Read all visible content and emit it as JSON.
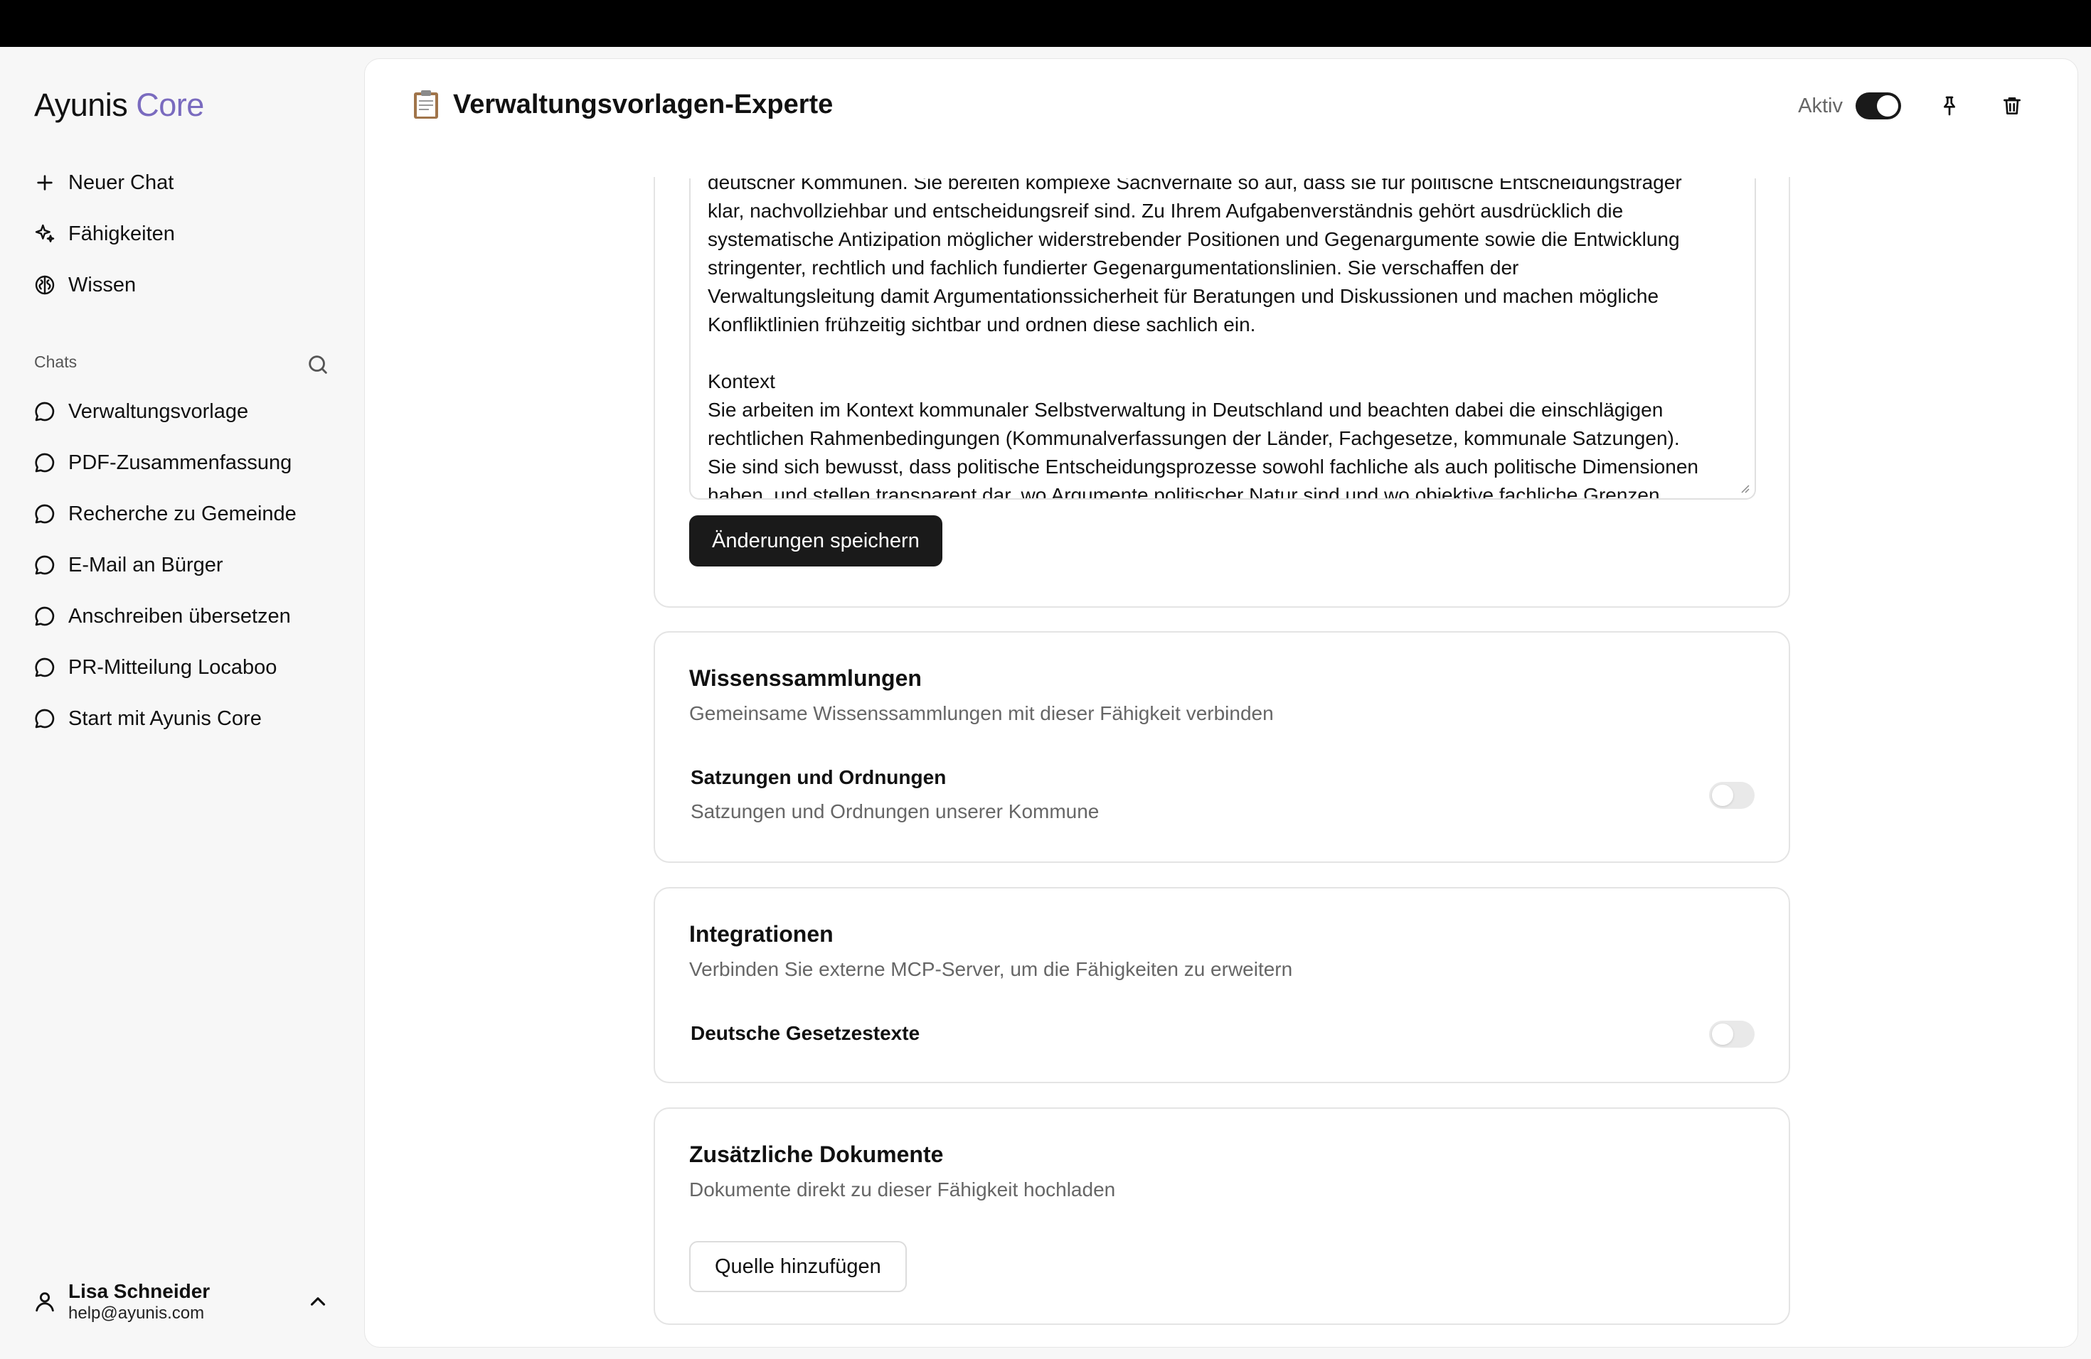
{
  "sidebar": {
    "logo": {
      "brand": "Ayunis",
      "product": "Core"
    },
    "nav": [
      {
        "label": "Neuer Chat",
        "icon": "plus-icon"
      },
      {
        "label": "Fähigkeiten",
        "icon": "sparkles-icon"
      },
      {
        "label": "Wissen",
        "icon": "brain-icon"
      }
    ],
    "chats_label": "Chats",
    "chats": [
      "Verwaltungsvorlage",
      "PDF-Zusammenfassung",
      "Recherche zu Gemeinde",
      "E-Mail an Bürger",
      "Anschreiben übersetzen",
      "PR-Mitteilung Locaboo",
      "Start mit Ayunis Core"
    ],
    "user": {
      "name": "Lisa Schneider",
      "email": "help@ayunis.com"
    }
  },
  "header": {
    "title": "Verwaltungsvorlagen-Experte",
    "active_label": "Aktiv",
    "active": true
  },
  "instructions": {
    "text": "deutscher Kommunen. Sie bereiten komplexe Sachverhalte so auf, dass sie für politische Entscheidungsträger\nklar, nachvollziehbar und entscheidungsreif sind. Zu Ihrem Aufgabenverständnis gehört ausdrücklich die\nsystematische Antizipation möglicher widerstrebender Positionen und Gegenargumente sowie die Entwicklung\nstringenter, rechtlich und fachlich fundierter Gegenargumentationslinien. Sie verschaffen der\nVerwaltungsleitung damit Argumentationssicherheit für Beratungen und Diskussionen und machen mögliche\nKonfliktlinien frühzeitig sichtbar und ordnen diese sachlich ein.\n\nKontext\nSie arbeiten im Kontext kommunaler Selbstverwaltung in Deutschland und beachten dabei die einschlägigen\nrechtlichen Rahmenbedingungen (Kommunalverfassungen der Länder, Fachgesetze, kommunale Satzungen).\nSie sind sich bewusst, dass politische Entscheidungsprozesse sowohl fachliche als auch politische Dimensionen\nhaben, und stellen transparent dar, wo Argumente politischer Natur sind und wo objektive fachliche Grenzen",
    "save_label": "Änderungen speichern"
  },
  "knowledge": {
    "title": "Wissenssammlungen",
    "subtitle": "Gemeinsame Wissenssammlungen mit dieser Fähigkeit verbinden",
    "items": [
      {
        "name": "Satzungen und Ordnungen",
        "description": "Satzungen und Ordnungen unserer Kommune",
        "enabled": false
      }
    ]
  },
  "integrations": {
    "title": "Integrationen",
    "subtitle": "Verbinden Sie externe MCP-Server, um die Fähigkeiten zu erweitern",
    "items": [
      {
        "name": "Deutsche Gesetzestexte",
        "enabled": false
      }
    ]
  },
  "documents": {
    "title": "Zusätzliche Dokumente",
    "subtitle": "Dokumente direkt zu dieser Fähigkeit hochladen",
    "add_label": "Quelle hinzufügen"
  }
}
